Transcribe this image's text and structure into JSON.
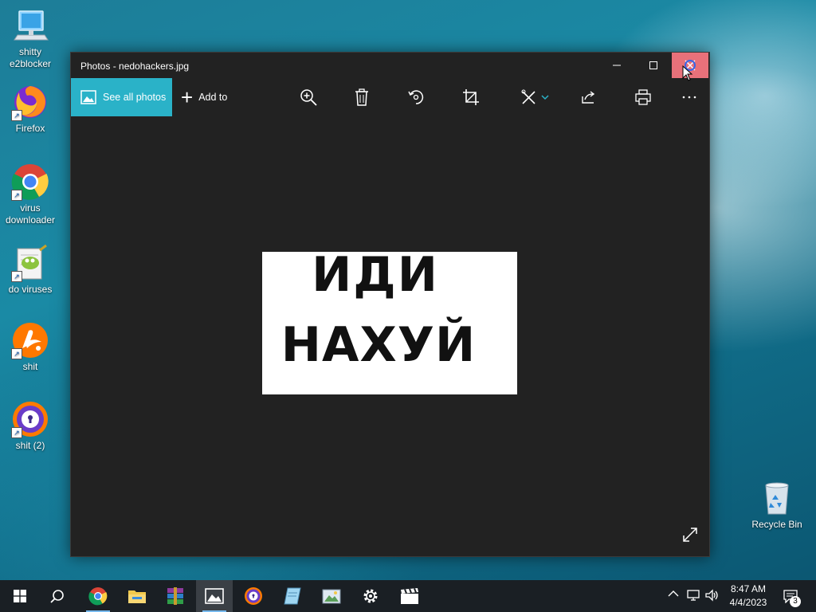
{
  "desktop": {
    "icons": [
      {
        "label": "shitty\ne2blocker",
        "icon": "computer-icon"
      },
      {
        "label": "Firefox",
        "icon": "firefox-icon"
      },
      {
        "label": "virus\ndownloader",
        "icon": "chrome-icon"
      },
      {
        "label": "do viruses",
        "icon": "notepad-plus-icon"
      },
      {
        "label": "shit",
        "icon": "avast-icon"
      },
      {
        "label": "shit (2)",
        "icon": "avast-secure-browser-icon"
      },
      {
        "label": "Recycle Bin",
        "icon": "recycle-bin-icon"
      }
    ]
  },
  "window": {
    "title": "Photos - nedohackers.jpg",
    "buttons": {
      "minimize": "minimize-icon",
      "maximize": "maximize-icon",
      "close": "close-icon"
    },
    "toolbar": {
      "see_all_photos": "See all photos",
      "add_to": "Add to",
      "tools": [
        "zoom-in-icon",
        "delete-icon",
        "rotate-icon",
        "crop-icon",
        "edit-icon",
        "share-icon",
        "print-icon",
        "more-icon"
      ]
    },
    "photo": {
      "line1": "ИДИ",
      "line2": "НАХУЙ"
    }
  },
  "taskbar": {
    "pinned": [
      "start-icon",
      "search-icon",
      "chrome-icon",
      "file-explorer-icon",
      "winrar-icon",
      "photos-icon",
      "avast-browser-icon",
      "notepad-icon",
      "image-viewer-icon",
      "settings-icon",
      "movies-tv-icon"
    ],
    "clock": {
      "time": "8:47 AM",
      "date": "4/4/2023"
    },
    "notification_count": "3"
  },
  "colors": {
    "accent": "#2ab2c8",
    "close_hover": "#e8717a",
    "window_bg": "#222222",
    "taskbar_bg": "#1a1f24"
  }
}
